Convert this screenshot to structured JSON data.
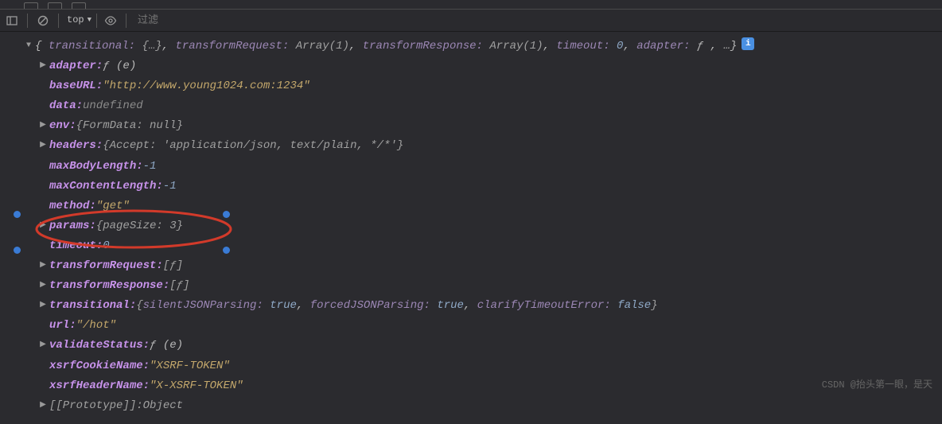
{
  "toolbar": {
    "context": "top",
    "filter_placeholder": "过滤"
  },
  "summary": {
    "prefix": "{",
    "p1k": "transitional:",
    "p1v": "{…}",
    "p2k": "transformRequest:",
    "p2v": "Array(1)",
    "p3k": "transformResponse:",
    "p3v": "Array(1)",
    "p4k": "timeout:",
    "p4v": "0",
    "p5k": "adapter:",
    "p5v": "ƒ",
    "suffix": ", …}"
  },
  "props": {
    "adapter_k": "adapter:",
    "adapter_v": "ƒ (e)",
    "baseURL_k": "baseURL:",
    "baseURL_v": "\"http://www.young1024.com:1234\"",
    "data_k": "data:",
    "data_v": "undefined",
    "env_k": "env:",
    "env_v": "{FormData: null}",
    "headers_k": "headers:",
    "headers_v": "{Accept: 'application/json, text/plain, */*'}",
    "maxBodyLength_k": "maxBodyLength:",
    "maxBodyLength_v": "-1",
    "maxContentLength_k": "maxContentLength:",
    "maxContentLength_v": "-1",
    "method_k": "method:",
    "method_v": "\"get\"",
    "params_k": "params:",
    "params_v": "{pageSize: 3}",
    "timeout_k": "timeout:",
    "timeout_v": "0",
    "transformRequest_k": "transformRequest:",
    "transformRequest_v": "[ƒ]",
    "transformResponse_k": "transformResponse:",
    "transformResponse_v": "[ƒ]",
    "transitional_k": "transitional:",
    "transitional_v_open": "{",
    "transitional_s1k": "silentJSONParsing:",
    "transitional_s1v": "true",
    "transitional_s2k": "forcedJSONParsing:",
    "transitional_s2v": "true",
    "transitional_s3k": "clarifyTimeoutError:",
    "transitional_s3v": "false",
    "transitional_v_close": "}",
    "url_k": "url:",
    "url_v": "\"/hot\"",
    "validateStatus_k": "validateStatus:",
    "validateStatus_v": "ƒ (e)",
    "xsrfCookieName_k": "xsrfCookieName:",
    "xsrfCookieName_v": "\"XSRF-TOKEN\"",
    "xsrfHeaderName_k": "xsrfHeaderName:",
    "xsrfHeaderName_v": "\"X-XSRF-TOKEN\"",
    "proto_k": "[[Prototype]]:",
    "proto_v": "Object"
  },
  "watermark": "CSDN @抬头第一眼，是天"
}
